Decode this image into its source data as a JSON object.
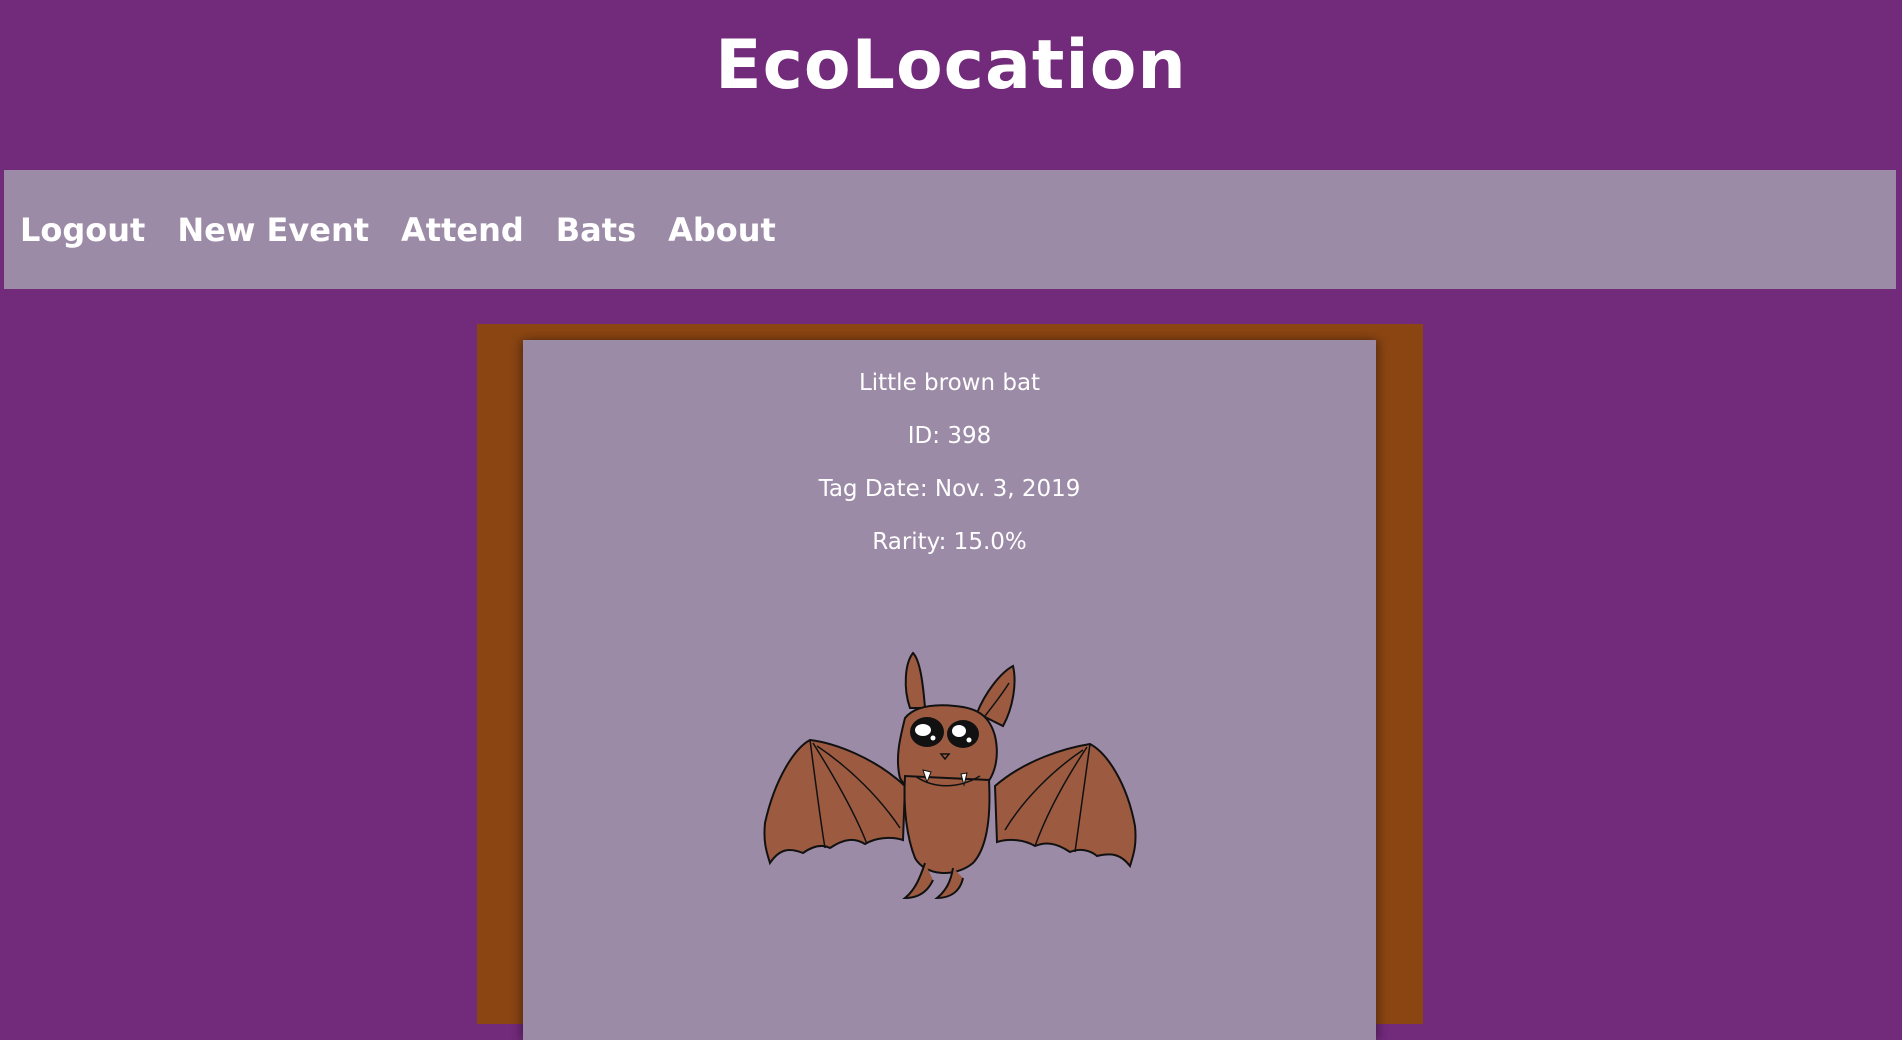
{
  "site": {
    "title": "EcoLocation"
  },
  "nav": {
    "items": [
      {
        "label": "Logout"
      },
      {
        "label": "New Event"
      },
      {
        "label": "Attend"
      },
      {
        "label": "Bats"
      },
      {
        "label": "About"
      }
    ]
  },
  "bat": {
    "name": "Little brown bat",
    "id": "ID: 398",
    "tag_date": "Tag Date: Nov. 3, 2019",
    "rarity": "Rarity: 15.0%",
    "illustration": "cartoon-bat-icon"
  },
  "colors": {
    "background": "#722a7b",
    "navbar": "#9c8ba7",
    "card": "#9c8ba7",
    "frame": "#8a4513",
    "bat_body": "#9c5b40"
  }
}
